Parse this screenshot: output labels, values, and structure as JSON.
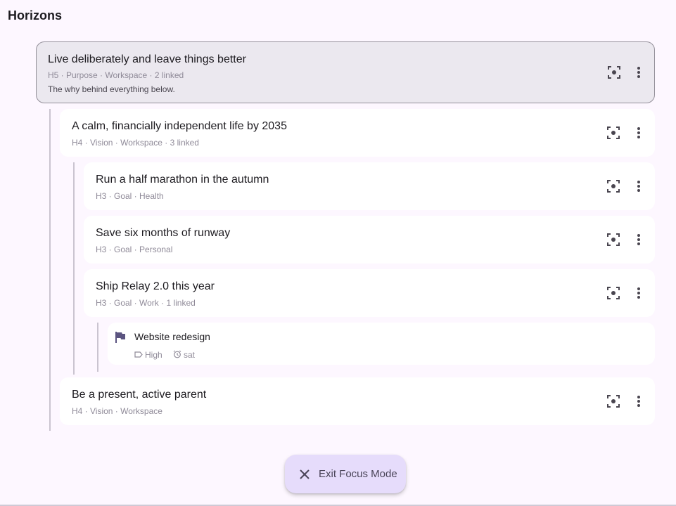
{
  "page": {
    "title": "Horizons"
  },
  "horizons": [
    {
      "title": "Live deliberately and leave things better",
      "meta": "H5 · Purpose · Workspace · 2 linked",
      "description": "The why behind everything below."
    },
    {
      "title": "A calm, financially independent life by 2035",
      "meta": "H4 · Vision · Workspace · 3 linked"
    },
    {
      "title": "Run a half marathon in the autumn",
      "meta": "H3 · Goal · Health"
    },
    {
      "title": "Save six months of runway",
      "meta": "H3 · Goal · Personal"
    },
    {
      "title": "Ship Relay 2.0 this year",
      "meta": "H3 · Goal · Work · 1 linked"
    },
    {
      "title": "Be a present, active parent",
      "meta": "H4 · Vision · Workspace"
    }
  ],
  "project": {
    "title": "Website redesign",
    "priority": "High",
    "due": "sat"
  },
  "fab": {
    "label": "Exit Focus Mode"
  },
  "colors": {
    "accent": "#e6dcfb",
    "selected_bg": "#ebe8ef",
    "icon": "#49454f",
    "flag": "#5b5480"
  },
  "icons": {
    "focus": "focus-frame-icon",
    "more": "more-vert-icon",
    "flag": "flag-icon",
    "close": "close-icon"
  }
}
